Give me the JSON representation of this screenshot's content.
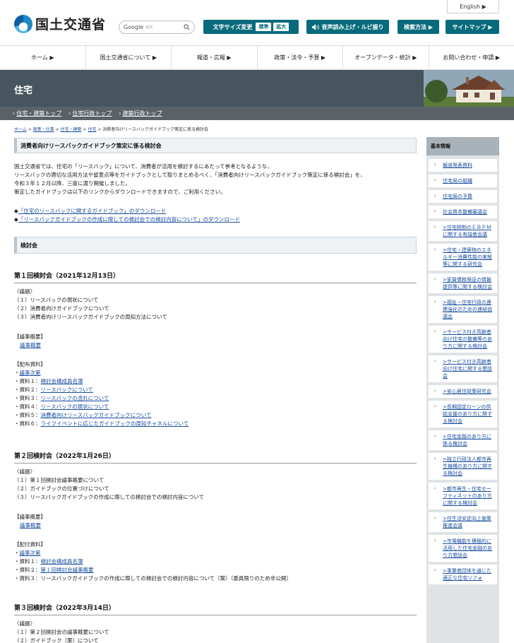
{
  "header": {
    "english_label": "English ▶",
    "logo_text": "国土交通省",
    "search_brand": "Google",
    "search_placeholder": "提供",
    "font_size_label": "文字サイズ変更",
    "font_standard": "標準",
    "font_large": "拡大",
    "voice_label": "音声読み上げ・ルビ振り",
    "search_method": "検索方法 ▶",
    "sitemap": "サイトマップ ▶"
  },
  "global_nav": [
    "ホーム ▶",
    "国土交通省について ▶",
    "報道・広報 ▶",
    "政策・法令・予算 ▶",
    "オープンデータ・統計 ▶",
    "お問い合わせ・申請 ▶"
  ],
  "hero_title": "住宅",
  "sub_nav": [
    "住宅・建築トップ",
    "住宅行政トップ",
    "建築行政トップ"
  ],
  "breadcrumb": [
    "ホーム",
    "政策・仕事",
    "住宅・建築",
    "住宅",
    "消費者向けリースバックガイドブック策定に係る検討会"
  ],
  "page_title": "消費者向けリースバックガイドブック策定に係る検討会",
  "intro": [
    "国土交通省では、住宅の「リースバック」について、消費者が活用を検討するにあたって参考となるような、",
    "リースバックの適切な活用方法や留意点等をガイドブックとして取りまとめるべく、「消費者向けリースバックガイドブック策定に係る検討会」を、",
    "令和３年１２月以降、三度に渡り開催しました。",
    "策定したガイドブックは以下のリンクからダウンロードできますので、ご利用ください。"
  ],
  "downloads": [
    {
      "prefix": "◆",
      "link": "「住宅のリースバックに関するガイドブック」",
      "suffix": "のダウンロード"
    },
    {
      "prefix": "◆",
      "link": "「リースバックガイドブックの作成に際しての検討会での検討内容について」",
      "suffix": "のダウンロード"
    }
  ],
  "section_title": "検討会",
  "meetings": [
    {
      "title": "第１回検討会（2021年12月13日）",
      "agenda_label": "〈議題〉",
      "agenda": [
        "（１）リースバックの現状について",
        "（２）消費者向けガイドブックについて",
        "（３）消費者向けリースバックガイドブックの周知方法について"
      ],
      "summary_label": "【議事概要】",
      "summary_link": "議事概要",
      "materials_label": "【配布資料】",
      "materials": [
        {
          "prefix": "・",
          "link": "議事次第",
          "suffix": ""
        },
        {
          "prefix": "・資料１：",
          "link": "検討会構成員名簿",
          "suffix": ""
        },
        {
          "prefix": "・資料２：",
          "link": "リースバックについて",
          "suffix": ""
        },
        {
          "prefix": "・資料３：",
          "link": "リースバックの流れについて",
          "suffix": ""
        },
        {
          "prefix": "・資料４：",
          "link": "リースバックの現状について",
          "suffix": ""
        },
        {
          "prefix": "・資料５：",
          "link": "消費者向けリースバックガイドブックについて",
          "suffix": ""
        },
        {
          "prefix": "・資料６：",
          "link": "ライフイベントに応じたガイドブックの周知チャネルについて",
          "suffix": ""
        }
      ]
    },
    {
      "title": "第２回検討会（2022年1月26日）",
      "agenda_label": "〈議題〉",
      "agenda": [
        "（１）第１回検討会議事概要について",
        "（２）ガイドブックの位置づけについて",
        "（３）リースバックガイドブックの作成に際しての検討会での検討内容について"
      ],
      "summary_label": "【議事概要】",
      "summary_link": "議事概要",
      "materials_label": "【配付資料】",
      "materials": [
        {
          "prefix": "・",
          "link": "議事次第",
          "suffix": ""
        },
        {
          "prefix": "・資料１：",
          "link": "検討会構成員名簿",
          "suffix": ""
        },
        {
          "prefix": "・資料２：",
          "link": "第１回検討会議事概要",
          "suffix": ""
        },
        {
          "prefix": "・資料３：リースバックガイドブックの作成に際しての検討会での検討内容について（案）（委員限りのため非公開）",
          "link": "",
          "suffix": ""
        }
      ]
    },
    {
      "title": "第３回検討会（2022年3月14日）",
      "agenda_label": "〈議題〉",
      "agenda": [
        "（１）第２回検討会の議事概要について",
        "（２）ガイドブック（案）について"
      ]
    }
  ],
  "sidebar": {
    "title": "基本情報",
    "items": [
      "報道発表資料",
      "住宅局の組織",
      "住宅局の予算",
      "社会資本整備審議会",
      ">住宅税制のＥＢＰＭに関する有識者会議",
      ">住宅・建築物のエネルギー消費性能の実態等に関する研究会",
      ">家賃債務保証の情報提供等に関する検討会",
      ">福祉・住宅行政の連携強化のための連絡協議会",
      ">サービス付き高齢者向け住宅の整備等のあり方に関する検討会",
      ">サービス付き高齢者向け住宅に関する懇談会",
      ">安心居住政策研究会",
      ">長期固定ローンの供給支援のあり方に関する検討会",
      ">住宅金融のあり方に係る検討会",
      ">独立行政法人都市再生機構のあり方に関する検討会",
      ">都市再生・住宅セーフティネットのあり方に関する検討会",
      ">住生活安定向上施策推進会議",
      ">市場機能を積極的に活用した住宅金融のあり方懇談会",
      ">事業者団体を通じた適正な住宅リフォ"
    ]
  }
}
